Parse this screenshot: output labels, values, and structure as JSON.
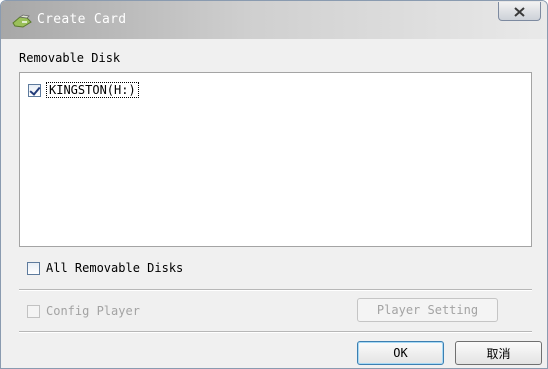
{
  "window": {
    "title": "Create Card"
  },
  "removable_disk": {
    "group_label": "Removable Disk",
    "items": [
      {
        "label": "KINGSTON(H:)",
        "checked": true
      }
    ]
  },
  "all_removable": {
    "label": "All Removable Disks",
    "checked": false
  },
  "config_player": {
    "label": "Config Player",
    "checked": false,
    "enabled": false
  },
  "buttons": {
    "player_setting": "Player Setting",
    "ok": "OK",
    "cancel": "取消"
  },
  "colors": {
    "title_gradient_start": "#a7a7a7",
    "title_gradient_end": "#e9e9e9",
    "disabled_text": "#a3a3a3",
    "dialog_bg": "#f0f0f0"
  }
}
